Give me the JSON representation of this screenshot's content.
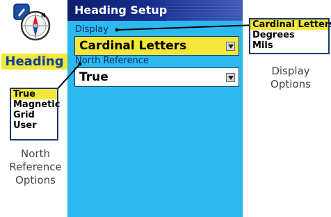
{
  "app": {
    "icon": "heading-compass-icon",
    "label": "Heading"
  },
  "screen": {
    "title": "Heading Setup",
    "display": {
      "label": "Display",
      "value": "Cardinal Letters",
      "highlight": "#f3e73a"
    },
    "north_reference": {
      "label": "North Reference",
      "value": "True"
    }
  },
  "display_options": {
    "items": [
      "Cardinal Letters",
      "Degrees",
      "Mils"
    ],
    "selected": "Cardinal Letters",
    "caption": [
      "Display",
      "Options"
    ]
  },
  "north_reference_options": {
    "items": [
      "True",
      "Magnetic",
      "Grid",
      "User"
    ],
    "selected": "True",
    "caption": [
      "North",
      "Reference",
      "Options"
    ]
  },
  "colors": {
    "screen_background": "#2cb9ee",
    "titlebar": "#0c1f6d",
    "highlight": "#f3e73a",
    "label_text": "#0b3f9c"
  }
}
